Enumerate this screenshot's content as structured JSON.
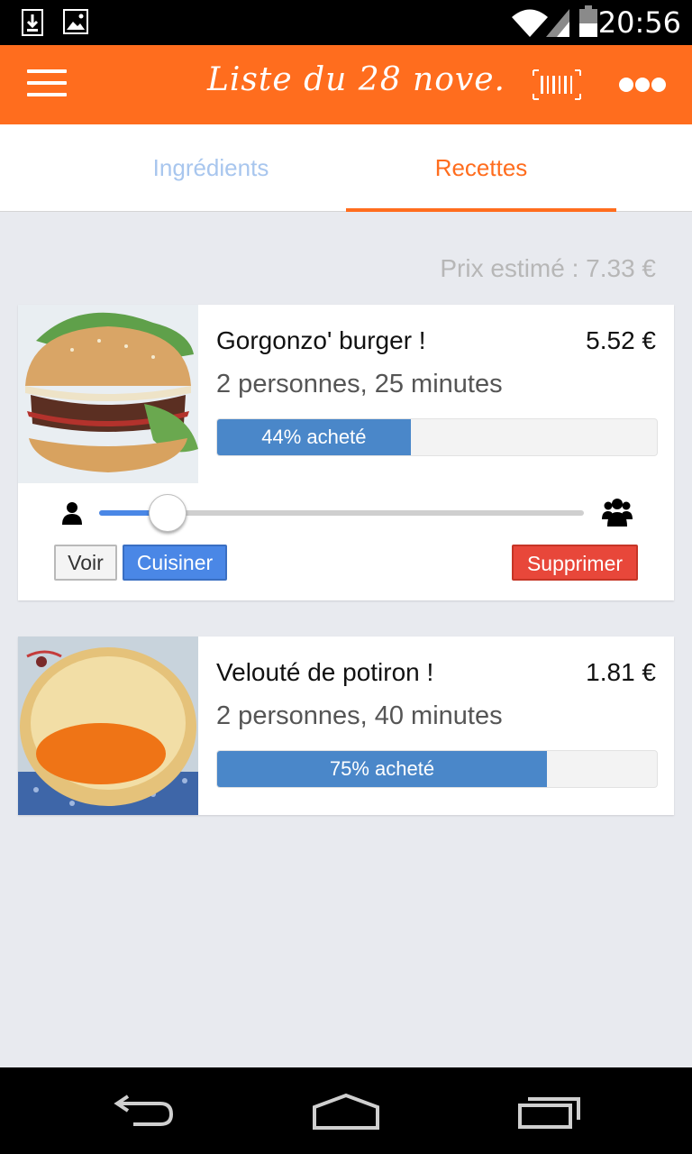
{
  "status_bar": {
    "time": "20:56",
    "icons": [
      "download-icon",
      "image-icon",
      "wifi-icon",
      "signal-icon",
      "battery-icon"
    ]
  },
  "app_bar": {
    "title": "Liste du 28 nove.",
    "menu_icon": "menu-icon",
    "barcode_icon": "barcode-icon",
    "more_icon": "more-icon"
  },
  "tabs": [
    {
      "label": "Ingrédients",
      "active": false
    },
    {
      "label": "Recettes",
      "active": true
    }
  ],
  "estimated_price": "Prix estimé : 7.33 €",
  "recipes": [
    {
      "name": "Gorgonzo' burger !",
      "price": "5.52 €",
      "meta": "2 personnes, 25 minutes",
      "progress_label": "44% acheté",
      "progress": 0.44,
      "expanded": true,
      "servings_slider": 0.14,
      "buttons": {
        "view": "Voir",
        "cook": "Cuisiner",
        "delete": "Supprimer"
      }
    },
    {
      "name": "Velouté de potiron !",
      "price": "1.81 €",
      "meta": "2 personnes, 40 minutes",
      "progress_label": "75% acheté",
      "progress": 0.75,
      "expanded": false
    }
  ],
  "nav_bar": {
    "icons": [
      "back-icon",
      "home-icon",
      "recent-apps-icon"
    ]
  },
  "colors": {
    "accent": "#ff6d1e",
    "progress": "#4a87c9",
    "primary_button": "#4a87e6",
    "danger_button": "#e8473a",
    "background": "#e8eaef"
  }
}
